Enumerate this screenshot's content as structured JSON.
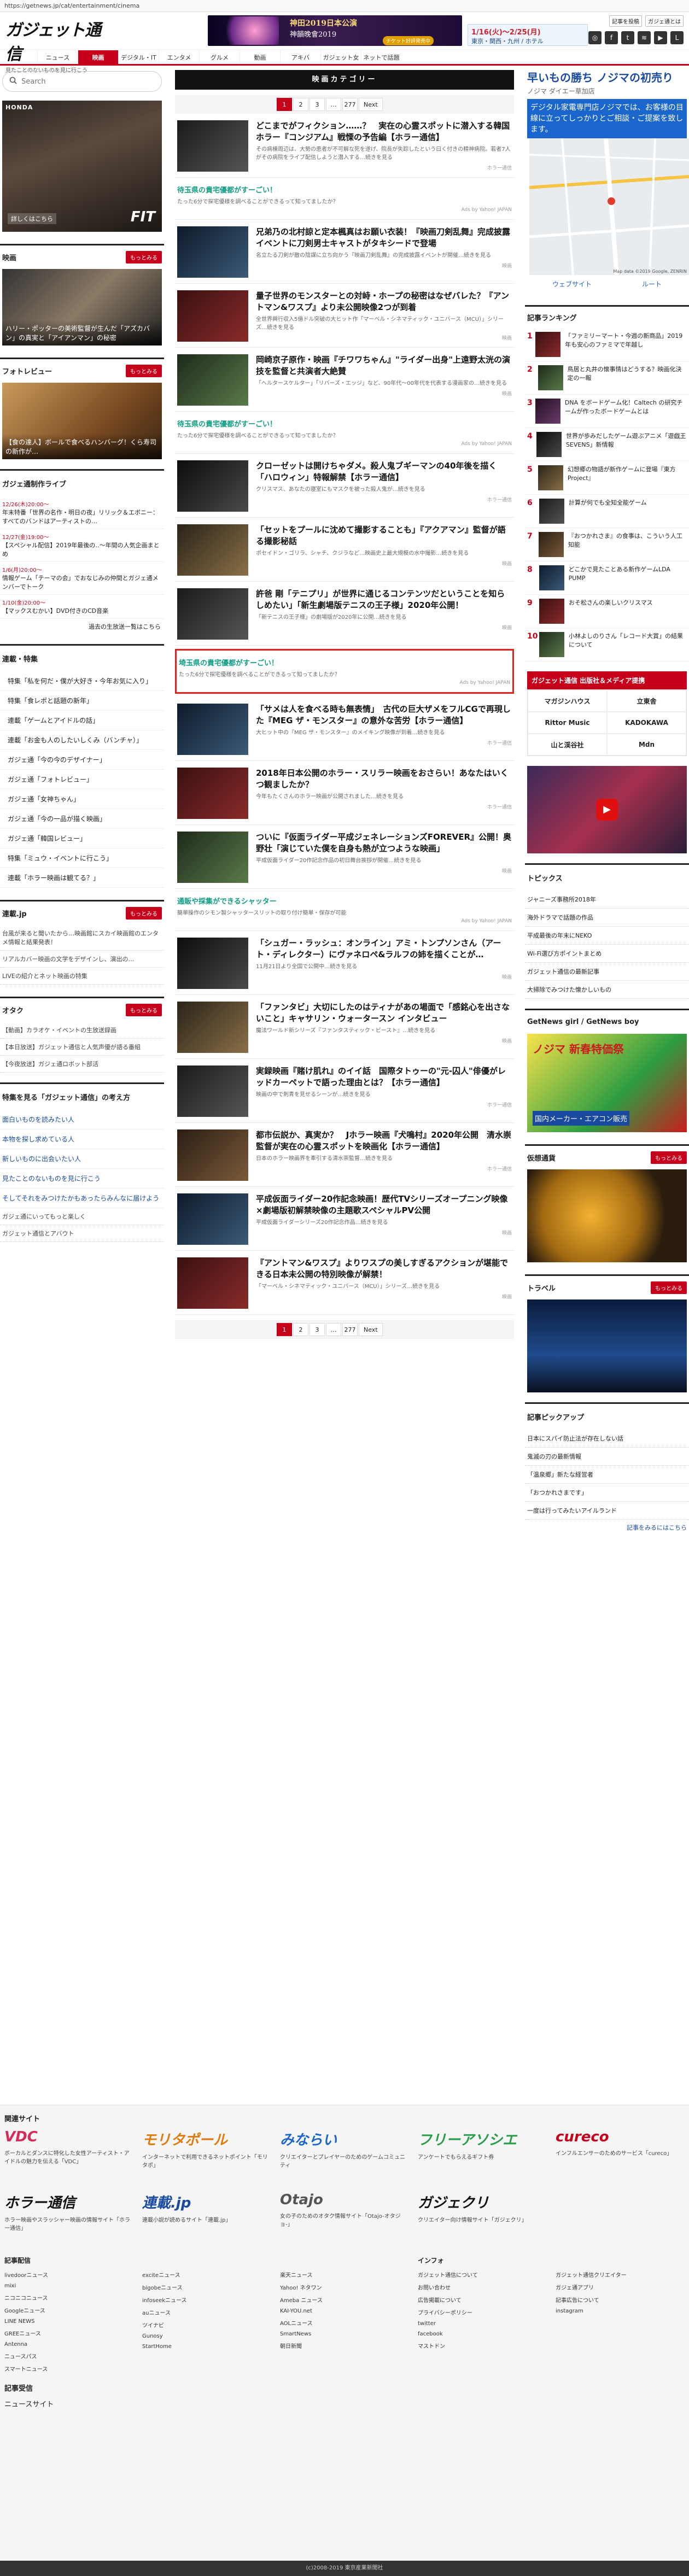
{
  "url": "https://getnews.jp/cat/entertainment/cinema",
  "site": {
    "logo": "ガジェット通信",
    "tagline": "見たことのないものを見に行こう"
  },
  "banner_kabuki": {
    "line1": "神田2019日本公演",
    "line2": "神韻晚會2019",
    "cta": "チケット好評発売中"
  },
  "banner_hotel": {
    "line1": "1/16(火)〜2/25(月)",
    "line2": "東京・関西・九州 / ホテル"
  },
  "header_links": {
    "register": "記事を投稿",
    "about": "ガジェ通とは"
  },
  "social_icons": [
    "instagram-icon",
    "facebook-icon",
    "twitter-icon",
    "rss-icon",
    "youtube-icon",
    "line-icon"
  ],
  "nav": [
    "ニュース",
    "映画",
    "デジタル・IT",
    "エンタメ",
    "グルメ",
    "動画",
    "アキバ",
    "ガジェット女子",
    "ネットで話題"
  ],
  "nav_active": 1,
  "search": {
    "placeholder": "Search"
  },
  "left": {
    "ad_car": {
      "brand": "HONDA",
      "model": "FIT",
      "more": "詳しくはこちら"
    },
    "movie_head": "映画",
    "more": "もっとみる",
    "movie_cap": "ハリー・ポッターの美術監督が生んだ「アズカバン」の真実と「アイアンマン」の秘密",
    "photo_head": "フォトレビュー",
    "photo_cap": "【食の達人】ボールで食べるハンバーグ！くら寿司の新作が…",
    "live_head": "ガジェ通制作ライブ",
    "live": [
      {
        "t": "12/26(木)20:00〜",
        "x": "年末特番「世界の名作・明日の夜」リリック＆エボニー：すべてのバンドはアーティストの…"
      },
      {
        "t": "12/27(金)19:00〜",
        "x": "【スペシャル配信】2019年最後の‥〜年間の人気企画まとめ"
      },
      {
        "t": "1/6(月)20:00〜",
        "x": "情報ゲーム「テーマの会」でおなじみの仲間とガジェ通メンバーでトーク"
      },
      {
        "t": "1/10(金)20:00〜",
        "x": "【マックスむかい】DVD付きのCD音楽"
      }
    ],
    "live_more": "過去の生放送一覧はこちら",
    "series_head": "連載・特集",
    "series": [
      "特集「私を何だ・僕が大好き・今年お気に入り」",
      "特集「食レポと話題の新年」",
      "連載「ゲームとアイドルの話」",
      "連載「お金も人のしたいしくみ（バンチャ）」",
      "ガジェ通「今の今のデザイナー」",
      "ガジェ通「フォトレビュー」",
      "ガジェ通「女神ちゃん」",
      "ガジェ通「今の一品が描く映画」",
      "ガジェ通「韓国レビュー」",
      "特集「ミュウ・イベントに行こう」",
      "連載「ホラー映画は観てる？」"
    ],
    "ent_head": "連載.jp",
    "ent": [
      "台風が来ると聞いたから…映画館にスカイ映画館のエンタメ情報と結果発表！",
      "リアルカバー映画の文学をデザインし、演出の…",
      "LIVEの紹介とネット映画の特集"
    ],
    "otaku_head": "オタク",
    "otaku": [
      "【動画】カラオケ・イベントの生放送録画",
      "【本日放送】ガジェット通信と人気声優が語る番組",
      "【今夜放送】ガジェ通ロボット部活"
    ],
    "tokusyu_head": "特集を見る「ガジェット通信」の考え方",
    "tokusyu": [
      "面白いものを読みたい人",
      "本物を探し求めている人",
      "新しいものに出会いたい人",
      "見たことのないものを見に行こう",
      "そしてそれをみつけたかもあったらみんなに届けよう"
    ],
    "tokusyu_more": [
      "ガジェ通にいってもっと楽しく",
      "ガジェット通信とアバウト"
    ]
  },
  "main": {
    "category_title": "映画カテゴリー",
    "pages": [
      "1",
      "2",
      "3",
      "…",
      "277",
      "Next"
    ],
    "articles": [
      {
        "title": "どこまでがフィクション……？　実在の心霊スポットに潜入する韓国ホラー『コンジアム』戦慄の予告編【ホラー通信】",
        "desc": "その病棟周辺は、大勢の患者が不可解な死を遂げ、院長が失踪したという曰く付きの精神病院。若者7人がその病院をライブ配信しようと潜入する…続きを見る",
        "meta": "ホラー通信"
      },
      {
        "pr": true,
        "title": "待玉県の貴宅優都がすーごい！",
        "desc": "たった6分で探宅優様を調べることができるって知ってましたか？",
        "meta": "Ads by Yahoo! JAPAN"
      },
      {
        "title": "兄弟乃の北村諒と定本楓真はお願い衣装！『映画刀剣乱舞』完成披露イベントに刀剣男士キャストがタキシードで登場",
        "desc": "名立たる刀剣が敵の陰謀に立ち向かう『映画刀剣乱舞』の完成披露イベントが開催…続きを見る",
        "meta": "映画"
      },
      {
        "title": "量子世界のモンスターとの対峙・ホープの秘密はなぜバレた？『アントマン&ワスプ』より未公開映像2つが到着",
        "desc": "全世界興行収入5億ドル突破の大ヒット作「マーベル・シネマティック・ユニバース（MCU）」シリーズ…続きを見る",
        "meta": "映画"
      },
      {
        "title": "岡崎京子原作・映画『チワワちゃん』\"ライダー出身\"上遠野太洸の演技を監督と共演者大絶賛",
        "desc": "「ヘルタースケルター」「リバーズ・エッジ」など、90年代〜00年代を代表する漫画家の…続きを見る",
        "meta": "映画"
      },
      {
        "pr": true,
        "title": "待玉県の貴宅優都がすーごい！",
        "desc": "たった6分で探宅優様を調べることができるって知ってましたか？",
        "meta": "Ads by Yahoo! JAPAN"
      },
      {
        "title": "クローゼットは開けちゃダメ。殺人鬼ブギーマンの40年後を描く「ハロウィン」特報解禁【ホラー通信】",
        "desc": "クリスマス、あなたの寝室にもマスクを被った殺人鬼が…続きを見る",
        "meta": "ホラー通信"
      },
      {
        "title": "「セットをプールに沈めて撮影することも」『アクアマン』監督が語る撮影秘話",
        "desc": "ポセイドン・ゴリラ、シャチ、クジラなど…映画史上最大規模の水中撮影…続きを見る",
        "meta": "映画"
      },
      {
        "title": "許爸 剛「テニプリ」が世界に通じるコンテンツだということを知らしめたい」「新生劇場版テニスの王子様」2020年公開！",
        "desc": "「新テニスの王子様」の劇場版が2020年に公開…続きを見る",
        "meta": "映画"
      },
      {
        "pr": true,
        "boxed": true,
        "title": "埼玉県の貴宅優都がすーごい！",
        "desc": "たった6分で探宅優様を調べることができるって知ってましたか？",
        "meta": "Ads by Yahoo! JAPAN"
      },
      {
        "title": "「サメは人を食べる時も無表情」　古代の巨大ザメをフルCGで再現した『MEG ザ・モンスター』の意外な苦労【ホラー通信】",
        "desc": "大ヒット中の『MEG ザ・モンスター』のメイキング映像が到着…続きを見る",
        "meta": "ホラー通信"
      },
      {
        "title": "2018年日本公開のホラー・スリラー映画をおさらい！あなたはいくつ観ましたか？",
        "desc": "今年もたくさんのホラー映画が公開されました…続きを見る",
        "meta": "ホラー通信"
      },
      {
        "title": "ついに『仮面ライダー平成ジェネレーションズFOREVER』公開！奥野壮「演じていた僕を自身も熱が立つような映画」",
        "desc": "平成仮面ライダー20作記念作品の初日舞台挨拶が開催…続きを見る",
        "meta": "映画"
      },
      {
        "pr": true,
        "title": "通販や採集ができるシャッター",
        "desc": "簡単操作のシモン製シャッタースリットの取り付け簡単・保存が可能",
        "meta": "Ads by Yahoo! JAPAN"
      },
      {
        "title": "「シュガー・ラッシュ：オンライン」アミ・トンプソンさん（アート・ディレクター）にヴァネロペ&ラルフの姉を描くことが…",
        "desc": "11月21日より全国で公開中…続きを見る",
        "meta": "映画"
      },
      {
        "title": "「ファンタビ」大切にしたのはティナがあの場面で「感銘心を出さないこと」キャサリン・ウォータースン インタビュー",
        "desc": "魔法ワールド新シリーズ『ファンタスティック・ビースト』…続きを見る",
        "meta": "映画"
      },
      {
        "title": "実録映画『賭け肌れ』のイイ話　国際タトゥーの\"元-囚人\"俳優がレッドカーペットで語った理由とは？【ホラー通信】",
        "desc": "映画の中で刺青を見せるシーンが…続きを見る",
        "meta": "ホラー通信"
      },
      {
        "title": "都市伝説か、真実か？　Jホラー映画『犬鳴村』2020年公開　清水崇監督が実在の心霊スポットを映画化【ホラー通信】",
        "desc": "日本のホラー映画界を牽引する清水崇監督…続きを見る",
        "meta": "ホラー通信"
      },
      {
        "title": "平成仮面ライダー20作記念映画！歴代TVシリーズオープニング映像×劇場版初解禁映像の主題歌スペシャルPV公開",
        "desc": "平成仮面ライダーシリーズ20作記念作品…続きを見る",
        "meta": "映画"
      },
      {
        "title": "『アントマン&ワスプ』よりワスプの美しすぎるアクションが堪能できる日本未公開の特別映像が解禁！",
        "desc": "「マーベル・シネマティック・ユニバース（MCU）」シリーズ…続きを見る",
        "meta": "映画"
      }
    ]
  },
  "right": {
    "map_ad": {
      "title": "早いもの勝ち ノジマの初売り",
      "sub": "ノジマ ダイエー草加店",
      "body": "デジタル家電専門店ノジマでは、お客様の目線に立ってしっかりとご相談・ご提案を致します。",
      "btn1": "ウェブサイト",
      "btn2": "ルート",
      "credit": "Map data ©2019 Google, ZENRIN"
    },
    "rank_head": "記事ランキング",
    "rank": [
      "「ファミリーマート・今週の新商品」2019年も安心のファミマで年越し",
      "鳥居と丸井の懐事情はどうする？映画化決定の一報",
      "DNA をボードゲーム化！Caltech の研究チームが作ったボードゲームとは",
      "世界が歩みだしたゲーム遊ぶアニメ「遊戯王SEVENS」新情報",
      "幻想郷の物語が新作ゲームに登場『東方Project』",
      "計算が何でも全知全能ゲーム",
      "『おつかれさま』の食事は、こういう人工知能",
      "どこかで見たことある新作ゲームLDA PUMP",
      "おそ松さんの楽しいクリスマス",
      "小林よしのりさん「レコード大賞」の結果について"
    ],
    "mag_head": "ガジェット通信 出版社＆メディア提携",
    "mag": [
      "マガジンハウス",
      "立東舎",
      "Rittor Music",
      "KADOKAWA",
      "山と渓谷社",
      "Mdn"
    ],
    "topics_head": "トピックス",
    "topics": [
      "ジャニーズ事務所2018年",
      "海外ドラマで話題の作品",
      "平成最後の年末にNEKO",
      "Wi-Fi選び方ポイントまとめ",
      "ガジェット通信の最新記事",
      "大掃除でみつけた懐かしいもの"
    ],
    "getnews_head": "GetNews girl / GetNews boy",
    "ad_nojima": {
      "title": "ノジマ 新春特価祭",
      "sub": "国内メーカー・エアコン販売"
    },
    "crypto_head": "仮想通貨",
    "travel_head": "トラベル",
    "pickup_head": "記事ピックアップ",
    "pickup": [
      "日本にスパイ防止法が存在しない話",
      "鬼滅の刃の最新情報",
      "「温泉郷」新たな経営者",
      "「おつかれさまです」",
      "一度は行ってみたいアイルランド"
    ],
    "more_btn": "記事をみるにはこちら"
  },
  "footer": {
    "related_head": "関連サイト",
    "sites": [
      {
        "logo": "VDC",
        "desc": "ボーカルとダンスに特化した女性アーティスト・アイドルの魅力を伝える「VDC」"
      },
      {
        "logo": "モリタポール",
        "desc": "インターネットで利用できるネットポイント「モリタポ」"
      },
      {
        "logo": "みならい",
        "desc": "クリエイターとプレイヤーのためのゲームコミュニティ"
      },
      {
        "logo": "フリーアソシエ",
        "desc": "アンケートでもらえるギフト券"
      },
      {
        "logo": "cureco",
        "desc": "インフルエンサーのためのサービス「cureco」"
      },
      {
        "logo": "ホラー通信",
        "desc": "ホラー映画やスラッシャー映画の情報サイト「ホラー通信」"
      },
      {
        "logo": "連載.jp",
        "desc": "連載小説が読めるサイト「連載.jp」"
      },
      {
        "logo": "Otajo",
        "desc": "女の子のためのオタク情報サイト「Otajo-オタジョ-」"
      },
      {
        "logo": "ガジェクリ",
        "desc": "クリエイター向け情報サイト「ガジェクリ」"
      }
    ],
    "col_heads": [
      "記事配信",
      "",
      "",
      "インフォ",
      ""
    ],
    "cols": [
      [
        "livedoorニュース",
        "mixi",
        "ニコニコニュース",
        "Googleニュース",
        "LINE NEWS",
        "GREEニュース",
        "Antenna",
        "ニュースパス",
        "スマートニュース"
      ],
      [
        "exciteニュース",
        "bigobeニュース",
        "infoseekニュース",
        "auニュース",
        "ツイナビ",
        "Gunosy",
        "StartHome"
      ],
      [
        "楽天ニュース",
        "Yahoo! ネタワン",
        "Ameba ニュース",
        "KAI-YOU.net",
        "AOLニュース",
        "SmartNews",
        "朝日新聞"
      ],
      [
        "ガジェット通信について",
        "お問い合わせ",
        "広告掲載について",
        "プライバシーポリシー",
        "twitter",
        "facebook",
        "マストドン"
      ],
      [
        "ガジェット通信クリエイター",
        "ガジェ通アプリ",
        "記事広告について",
        "instagram"
      ]
    ],
    "syndication_head": "記事受信",
    "syndication": [
      "ニュースサイト"
    ],
    "copyright": "(c)2008-2019 東京産業新聞社"
  }
}
